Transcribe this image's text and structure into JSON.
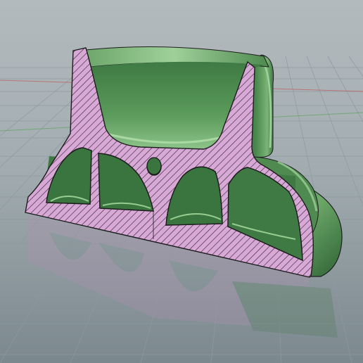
{
  "viewport": {
    "label": "",
    "background_top": "#aeb6ba",
    "background_bottom": "#7f8d93",
    "grid_color": "#8f9ba0",
    "axis_x_color": "#c44a4a",
    "axis_y_color": "#4fa04f"
  },
  "model": {
    "body_color": "#4f8a50",
    "body_dark": "#2d5e34",
    "body_light": "#8fc08a",
    "section_fill": "#d8a9d6",
    "hatch_color": "#3a2a3a",
    "outline_color": "#1d1d1d"
  }
}
